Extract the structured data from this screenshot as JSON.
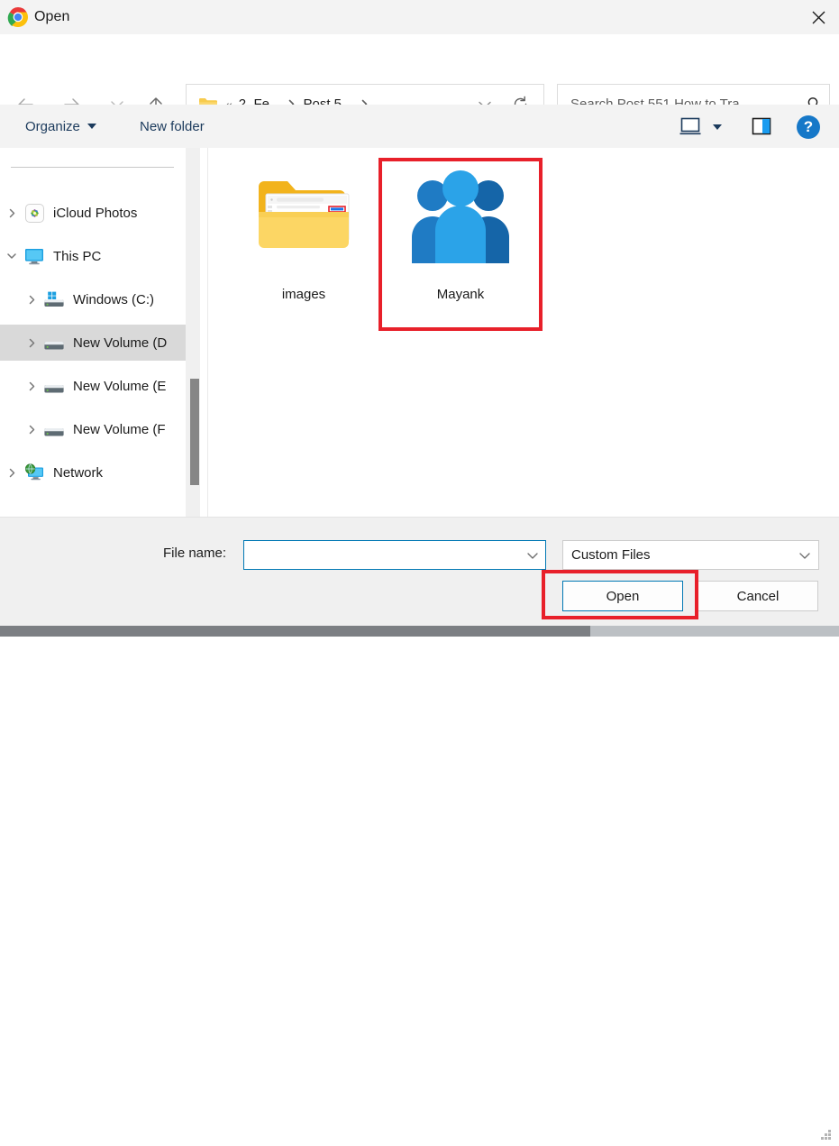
{
  "window": {
    "title": "Open",
    "app_icon": "chrome-logo-icon",
    "close_label": "✕"
  },
  "nav": {
    "back": "back-arrow-icon",
    "forward": "forward-arrow-icon",
    "recent": "chevron-down-icon",
    "up": "up-arrow-icon",
    "address": {
      "folder_icon": "folder-icon",
      "overflow": "«",
      "crumbs": [
        {
          "label": "2. Fe..."
        },
        {
          "label": "Post 5..."
        }
      ],
      "dropdown_icon": "chevron-down-icon",
      "refresh_icon": "refresh-icon"
    },
    "search": {
      "placeholder": "Search Post 551 How to Tra...",
      "value": "",
      "icon": "search-icon"
    }
  },
  "commandbar": {
    "organize_label": "Organize",
    "organize_caret_icon": "caret-down-icon",
    "new_folder_label": "New folder",
    "view_icon": "view-layout-icon",
    "view_caret_icon": "caret-down-icon",
    "preview_pane_icon": "preview-pane-icon",
    "help_label": "?"
  },
  "navpane": {
    "items": [
      {
        "label": "iCloud Photos",
        "icon": "icloud-photos-icon",
        "expanded": false,
        "indent": 0,
        "selected": false
      },
      {
        "label": "This PC",
        "icon": "this-pc-icon",
        "expanded": true,
        "indent": 0,
        "selected": false
      },
      {
        "label": "Windows (C:)",
        "icon": "windows-drive-icon",
        "expanded": false,
        "indent": 1,
        "selected": false
      },
      {
        "label": "New Volume (D",
        "icon": "drive-icon",
        "expanded": false,
        "indent": 1,
        "selected": true
      },
      {
        "label": "New Volume (E",
        "icon": "drive-icon",
        "expanded": false,
        "indent": 1,
        "selected": false
      },
      {
        "label": "New Volume (F",
        "icon": "drive-icon",
        "expanded": false,
        "indent": 1,
        "selected": false
      },
      {
        "label": "Network",
        "icon": "network-icon",
        "expanded": false,
        "indent": 0,
        "selected": false
      }
    ]
  },
  "filelist": {
    "items": [
      {
        "name": "images",
        "icon": "folder-with-preview-icon",
        "highlighted": false
      },
      {
        "name": "Mayank",
        "icon": "people-group-icon",
        "highlighted": true
      }
    ]
  },
  "footer": {
    "filename_label": "File name:",
    "filename_value": "",
    "filename_caret_icon": "chevron-down-icon",
    "filetype_value": "Custom Files",
    "filetype_caret_icon": "chevron-down-icon",
    "open_label": "Open",
    "cancel_label": "Cancel",
    "resize_grip_icon": "resize-grip-icon"
  },
  "colors": {
    "accent_blue": "#0078b4",
    "highlight_red": "#e8202a",
    "command_text": "#1b3a5c",
    "selected_row": "#d9d9d9"
  }
}
